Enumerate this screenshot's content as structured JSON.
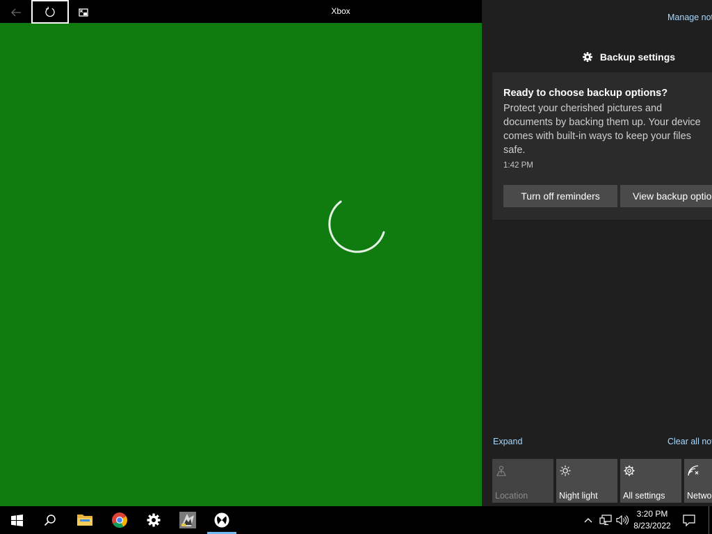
{
  "app": {
    "title": "Xbox",
    "background": "#107c10",
    "loading": true
  },
  "titlebar": {
    "back_icon": "back-arrow-icon",
    "refresh_icon": "refresh-icon",
    "compact_icon": "compact-overlay-icon"
  },
  "action_center": {
    "manage_link": "Manage notifications",
    "group_header": "Backup settings",
    "notification": {
      "title": "Ready to choose backup options?",
      "body": "Protect your cherished pictures and documents by backing them up. Your device comes with built-in ways to keep your files safe.",
      "time": "1:42 PM",
      "buttons": [
        "Turn off reminders",
        "View backup options"
      ]
    },
    "expand_link": "Expand",
    "clear_link": "Clear all notifications",
    "quick_actions": [
      {
        "label": "Location",
        "icon": "location-icon",
        "enabled": false
      },
      {
        "label": "Night light",
        "icon": "night-light-icon",
        "enabled": true
      },
      {
        "label": "All settings",
        "icon": "settings-gear-icon",
        "enabled": true
      },
      {
        "label": "Network",
        "icon": "network-icon",
        "enabled": true
      }
    ]
  },
  "taskbar": {
    "apps": [
      "start-icon",
      "search-icon",
      "file-explorer-icon",
      "chrome-icon",
      "settings-icon",
      "app-icon",
      "xbox-icon"
    ],
    "active_app": "xbox-icon",
    "clock_time": "3:20 PM",
    "clock_date": "8/23/2022"
  },
  "colors": {
    "accent_link": "#a6d8ff",
    "active_underline": "#76b9ed",
    "action_center_bg": "#1f1f1f",
    "card_bg": "#2b2b2b",
    "button_bg": "#4a4a4a"
  }
}
